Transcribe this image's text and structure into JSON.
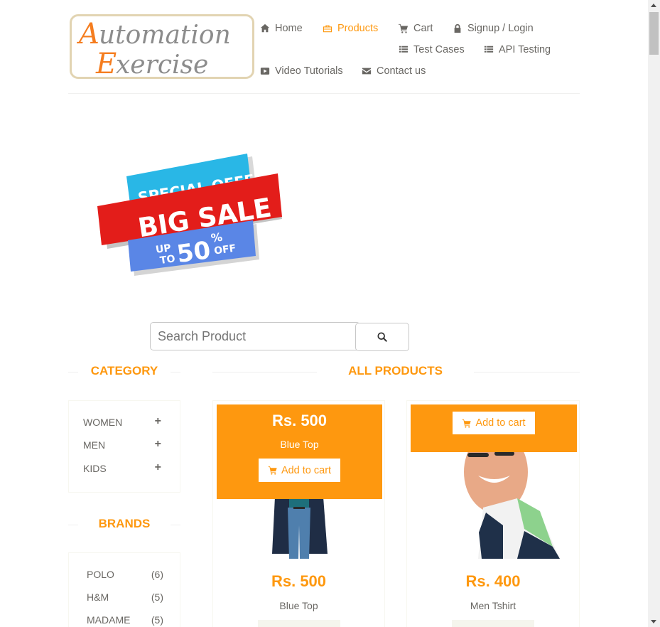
{
  "logo": {
    "line1_first": "A",
    "line1_rest": "utomation",
    "line2_first": "E",
    "line2_rest": "xercise"
  },
  "nav": {
    "home": "Home",
    "products": "Products",
    "cart": "Cart",
    "signup": "Signup / Login",
    "test_cases": "Test Cases",
    "api_testing": "API Testing",
    "video": "Video Tutorials",
    "contact": "Contact us"
  },
  "banner": {
    "line1": "SPECIAL OFFER",
    "line2": "BIG SALE",
    "up": "UP",
    "to": "TO",
    "pct": "50",
    "pct_sign": "%",
    "off": "OFF"
  },
  "search": {
    "placeholder": "Search Product"
  },
  "category": {
    "title": "CATEGORY",
    "items": [
      {
        "label": "WOMEN"
      },
      {
        "label": "MEN"
      },
      {
        "label": "KIDS"
      }
    ]
  },
  "brands": {
    "title": "BRANDS",
    "items": [
      {
        "label": "POLO",
        "count": "(6)"
      },
      {
        "label": "H&M",
        "count": "(5)"
      },
      {
        "label": "MADAME",
        "count": "(5)"
      }
    ]
  },
  "products": {
    "title": "ALL PRODUCTS",
    "add_to_cart": "Add to cart",
    "items": [
      {
        "name": "Blue Top",
        "price": "Rs. 500"
      },
      {
        "name": "Men Tshirt",
        "price": "Rs. 400"
      }
    ]
  },
  "colors": {
    "accent": "#fe980f",
    "text": "#696763"
  }
}
